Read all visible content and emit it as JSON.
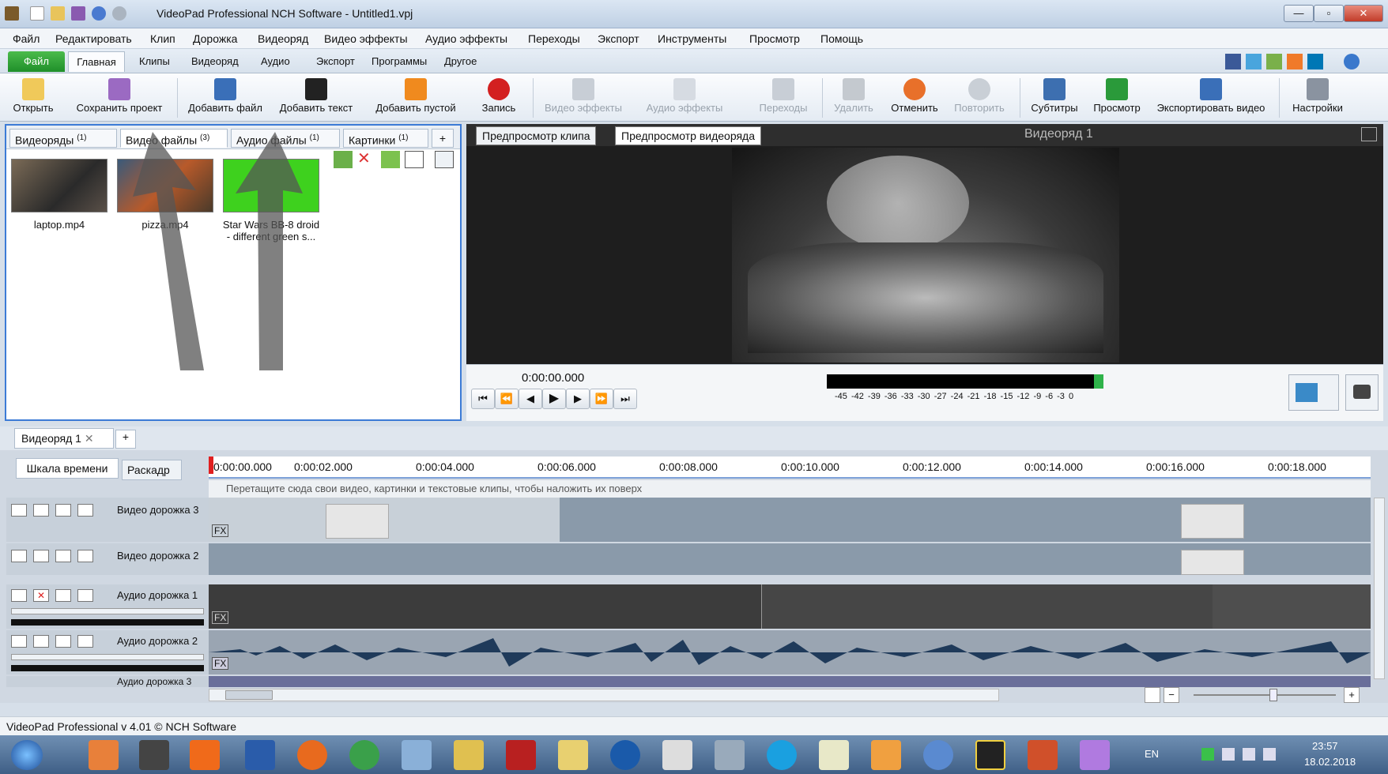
{
  "window": {
    "title": "VideoPad Professional NCH Software - Untitled1.vpj"
  },
  "menu": [
    "Файл",
    "Редактировать",
    "Клип",
    "Дорожка",
    "Видеоряд",
    "Видео эффекты",
    "Аудио эффекты",
    "Переходы",
    "Экспорт",
    "Инструменты",
    "Просмотр",
    "Помощь"
  ],
  "ribbon_tabs": [
    "Файл",
    "Главная",
    "Клипы",
    "Видеоряд",
    "Аудио",
    "Экспорт",
    "Программы",
    "Другое"
  ],
  "ribbon_buttons": [
    "Открыть",
    "Сохранить проект",
    "Добавить файл",
    "Добавить текст",
    "Добавить пустой",
    "Запись",
    "Видео эффекты",
    "Аудио эффекты",
    "Переходы",
    "Удалить",
    "Отменить",
    "Повторить",
    "Субтитры",
    "Просмотр",
    "Экспортировать видео",
    "Настройки"
  ],
  "bins": {
    "tabs": [
      {
        "label": "Видеоряды",
        "count": "(1)"
      },
      {
        "label": "Видео файлы",
        "count": "(3)"
      },
      {
        "label": "Аудио файлы",
        "count": "(1)"
      },
      {
        "label": "Картинки",
        "count": "(1)"
      },
      {
        "label": "+"
      }
    ],
    "files": [
      {
        "name": "laptop.mp4"
      },
      {
        "name": "pizza.mp4"
      },
      {
        "name": "Star Wars BB-8 droid - different green s..."
      }
    ]
  },
  "preview": {
    "tab_clip": "Предпросмотр клипа",
    "tab_sequence": "Предпросмотр видеоряда",
    "title": "Видеоряд 1",
    "time": "0:00:00.000",
    "level_ticks": "-45 -42 -39 -36 -33 -30 -27 -24 -21 -18 -15 -12 -9 -6 -3 0"
  },
  "sequence": {
    "tab": "Видеоряд 1",
    "add": "+"
  },
  "timeline": {
    "view_tabs": [
      "Шкала времени",
      "Раскадр"
    ],
    "ticks": [
      "0:00:00.000",
      "0:00:02.000",
      "0:00:04.000",
      "0:00:06.000",
      "0:00:08.000",
      "0:00:10.000",
      "0:00:12.000",
      "0:00:14.000",
      "0:00:16.000",
      "0:00:18.000"
    ],
    "overlay_hint": "Перетащите сюда свои видео, картинки и текстовые клипы, чтобы наложить их поверх",
    "tracks": [
      "Видео дорожка 3",
      "Видео дорожка 2",
      "Аудио дорожка 1",
      "Аудио дорожка 2",
      "Аудио дорожка 3"
    ],
    "fx": "FX"
  },
  "status": {
    "text": "VideoPad Professional v 4.01 © NCH Software"
  },
  "tray": {
    "lang": "EN",
    "time": "23:57",
    "date": "18.02.2018"
  },
  "colors": {
    "accent": "#3c7bd6",
    "file_tab": "#2a9a32",
    "record": "#d32020",
    "level_green": "#2fb34a"
  }
}
